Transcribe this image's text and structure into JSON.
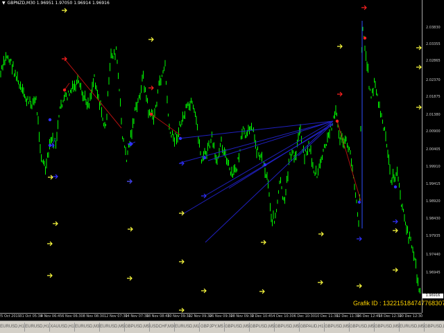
{
  "header": {
    "symbol": "GBPNZD,M30",
    "ohlc": "1.96951 1.97050 1.96914 1.96916"
  },
  "chart": {
    "candle_color": "#00ff00",
    "buy_line_color": "#2020c0",
    "sell_line_color": "#b01010",
    "signal_yellow": "#ffff40",
    "signal_red": "#ff2020",
    "signal_blue": "#3030ff"
  },
  "price_axis": {
    "ticks": [
      "2.03830",
      "2.03355",
      "2.02865",
      "2.02370",
      "2.01875",
      "2.01380",
      "2.00900",
      "2.00405",
      "1.99910",
      "1.99415",
      "1.98920",
      "1.98430",
      "1.97935",
      "1.97440",
      "1.96945"
    ],
    "current_price": "1.96916"
  },
  "time_axis": {
    "labels": [
      "25 Oct 2019",
      "31 Oct 05:30",
      "4 Nov 06:45",
      "6 Nov 06:30",
      "8 Nov 08:30",
      "12 Nov 07:30",
      "14 Nov 07:30",
      "18 Nov 08:45",
      "20 Nov 09:30",
      "22 Nov 09:30",
      "26 Nov 09:30",
      "28 Nov 09:30",
      "2 Dec 10:45",
      "4 Dec 10:30",
      "6 Dec 10:30",
      "10 Dec 11:30",
      "12 Dec 11:30",
      "16 Dec 12:45",
      "18 Dec 12:30",
      "20 Dec 12:30"
    ]
  },
  "grafik_id": "Grafik ID : 132215184747768307",
  "tabs": [
    "EURUSD,H1",
    "EURUSD,H1",
    "XAUUSD,H1",
    "EURUSD,M30",
    "EURUSD,M5",
    "GBPUSD,M5",
    "USDCHF,M30",
    "EURUSD,M15",
    "GBPJPY,M5",
    "GBPUSD,M5",
    "GBPUSD,M5",
    "GBPUSD,M5",
    "GBPAUD,H1",
    "GBPUSD,M5",
    "GBPUSD,M5",
    "GBPUSD,M5",
    "EURUSD,M5",
    "GBPUSD,M5",
    "GBF"
  ],
  "active_tab_index": 18
}
